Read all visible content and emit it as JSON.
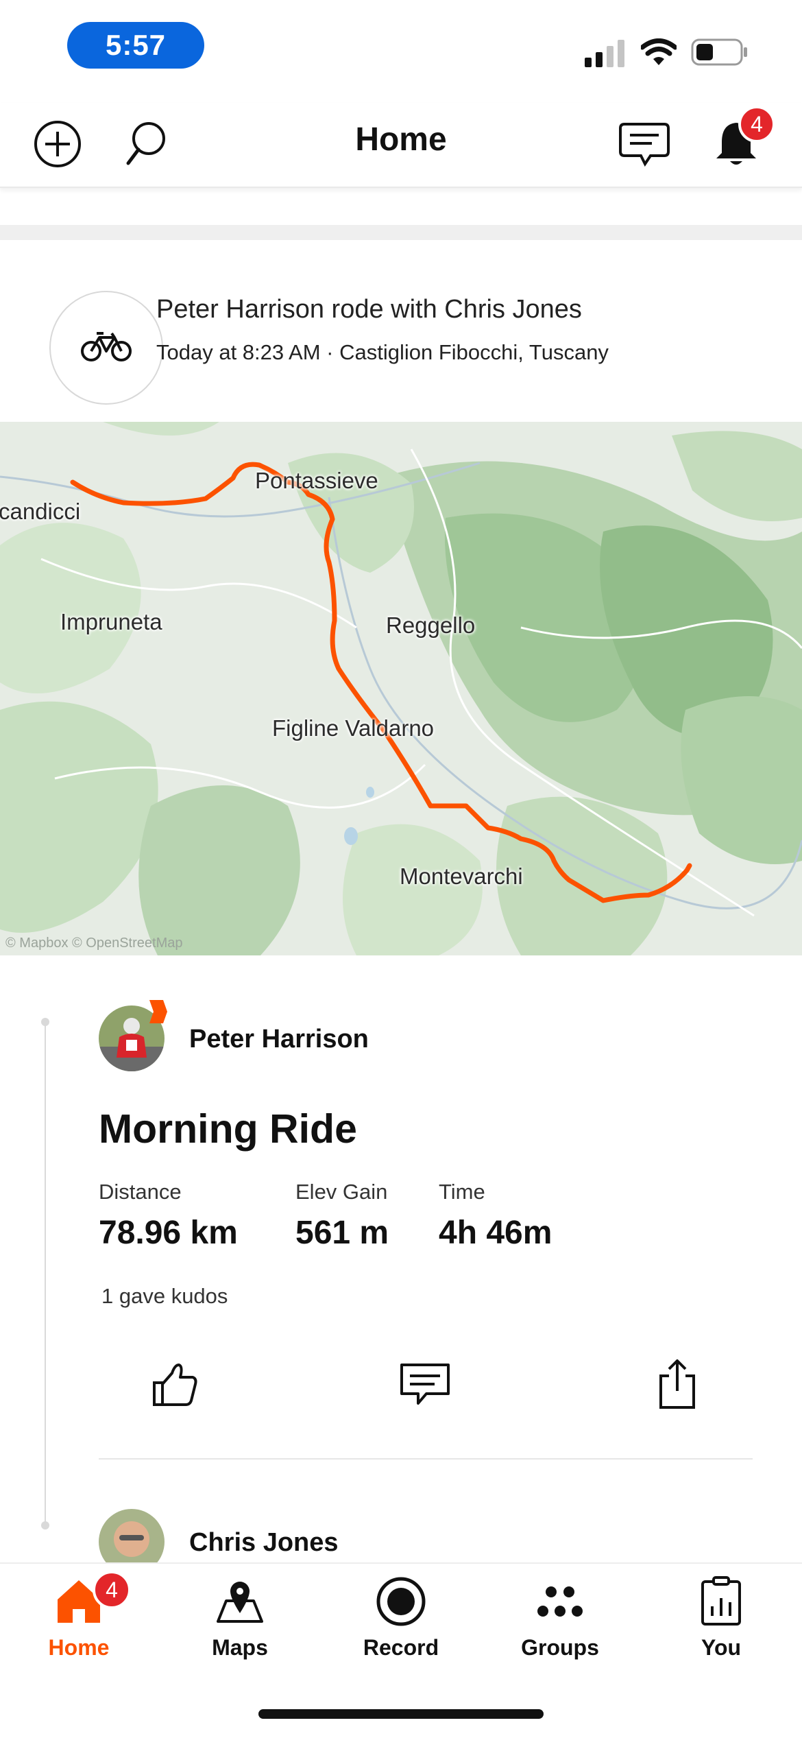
{
  "status_bar": {
    "time": "5:57"
  },
  "header": {
    "title": "Home",
    "notification_count": "4",
    "icons": [
      "add-circle-icon",
      "search-icon",
      "messages-icon",
      "bell-icon"
    ]
  },
  "activity": {
    "type_icon": "bike-icon",
    "headline": "Peter Harrison rode with Chris Jones",
    "subline": "Today at 8:23 AM · Castiglion Fibocchi, Tuscany",
    "map": {
      "labels": {
        "scandicci": "candicci",
        "pontassieve": "Pontassieve",
        "impruneta": "Impruneta",
        "reggello": "Reggello",
        "figline": "Figline Valdarno",
        "montevarchi": "Montevarchi"
      },
      "attribution": "© Mapbox © OpenStreetMap",
      "route_color": "#fc5200"
    },
    "athlete": {
      "name": "Peter Harrison"
    },
    "title": "Morning Ride",
    "stats": [
      {
        "label": "Distance",
        "value": "78.96 km"
      },
      {
        "label": "Elev Gain",
        "value": "561 m"
      },
      {
        "label": "Time",
        "value": "4h 46m"
      }
    ],
    "kudos_text": "1 gave kudos",
    "actions": [
      "thumbs-up-icon",
      "comment-icon",
      "share-icon"
    ],
    "second_athlete": {
      "name": "Chris Jones"
    }
  },
  "tabbar": {
    "tabs": [
      {
        "label": "Home",
        "icon": "home-icon",
        "active": true
      },
      {
        "label": "Maps",
        "icon": "maps-icon"
      },
      {
        "label": "Record",
        "icon": "record-icon"
      },
      {
        "label": "Groups",
        "icon": "groups-icon"
      },
      {
        "label": "You",
        "icon": "you-icon"
      }
    ],
    "home_badge": "4"
  },
  "colors": {
    "brand": "#fc5200",
    "badge": "#e3262a",
    "status_pill": "#0a66dd"
  }
}
